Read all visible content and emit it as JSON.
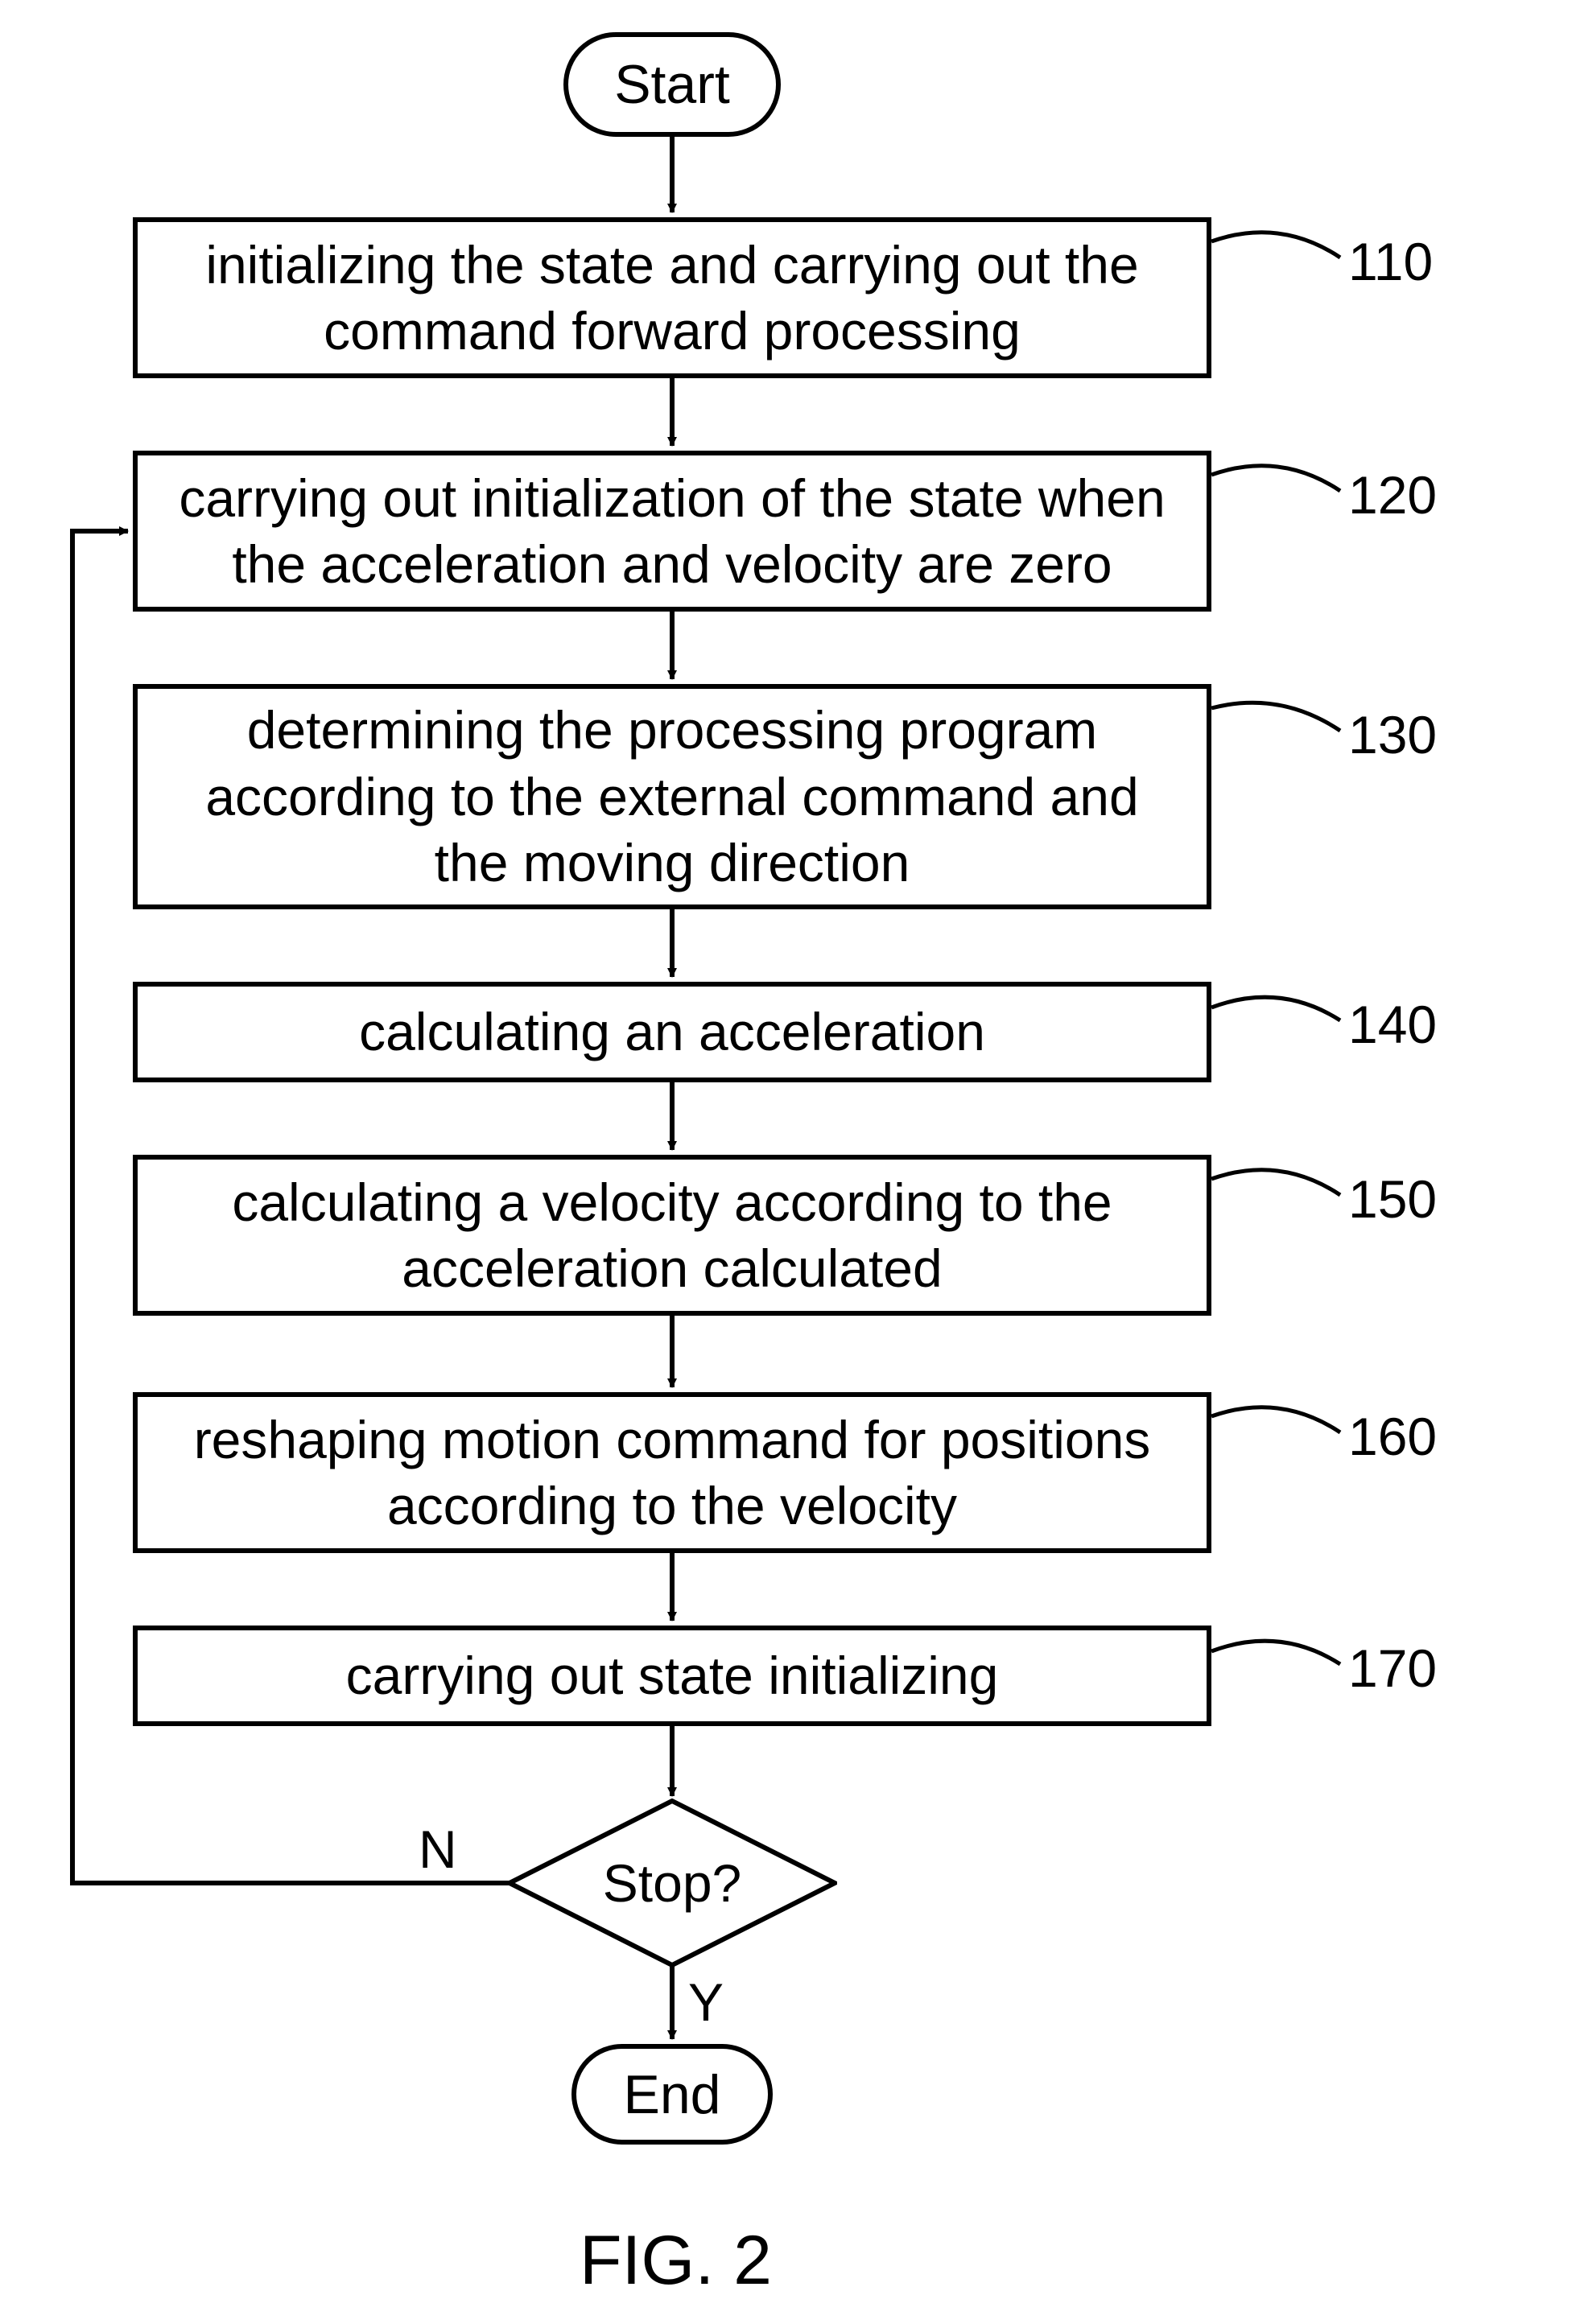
{
  "terminals": {
    "start": "Start",
    "end": "End"
  },
  "steps": {
    "s110": "initializing the state and carrying out the command forward processing",
    "s120": "carrying out initialization of the state when the acceleration and velocity are zero",
    "s130": "determining the processing program according to the external command and the moving direction",
    "s140": "calculating an acceleration",
    "s150": "calculating a velocity according to the acceleration calculated",
    "s160": "reshaping motion command for positions according to the velocity",
    "s170": "carrying out state initializing"
  },
  "refs": {
    "r110": "110",
    "r120": "120",
    "r130": "130",
    "r140": "140",
    "r150": "150",
    "r160": "160",
    "r170": "170"
  },
  "decision": {
    "label": "Stop?",
    "no": "N",
    "yes": "Y"
  },
  "figure": "FIG. 2"
}
